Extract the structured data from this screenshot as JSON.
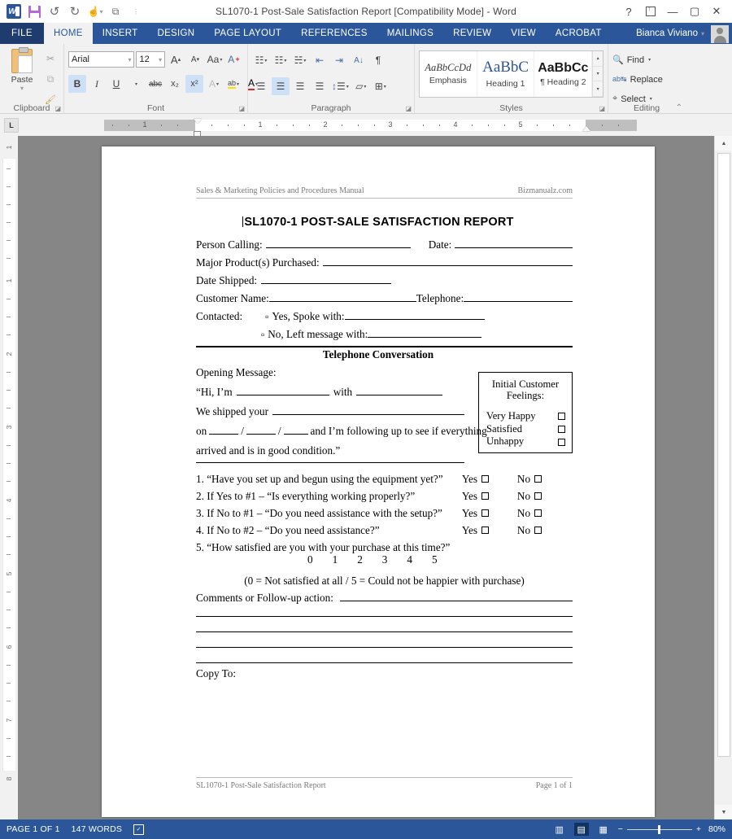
{
  "window": {
    "title": "SL1070-1 Post-Sale Satisfaction Report [Compatibility Mode] - Word",
    "qat": [
      {
        "name": "word-logo",
        "label": "W"
      },
      {
        "name": "save-icon",
        "label": ""
      },
      {
        "name": "undo-icon",
        "label": "↺"
      },
      {
        "name": "redo-icon",
        "label": "↻"
      },
      {
        "name": "touch-mode-icon",
        "label": ""
      },
      {
        "name": "customize-qat-icon",
        "label": "⌄"
      }
    ],
    "controls": {
      "help": "?",
      "ribbon_display": "ribbon-options",
      "minimize": "—",
      "maximize": "▢",
      "close": "✕"
    },
    "account": "Bianca Viviano"
  },
  "tabs": [
    {
      "id": "file",
      "label": "FILE",
      "active": false
    },
    {
      "id": "home",
      "label": "HOME",
      "active": true
    },
    {
      "id": "insert",
      "label": "INSERT",
      "active": false
    },
    {
      "id": "design",
      "label": "DESIGN",
      "active": false
    },
    {
      "id": "page-layout",
      "label": "PAGE LAYOUT",
      "active": false
    },
    {
      "id": "references",
      "label": "REFERENCES",
      "active": false
    },
    {
      "id": "mailings",
      "label": "MAILINGS",
      "active": false
    },
    {
      "id": "review",
      "label": "REVIEW",
      "active": false
    },
    {
      "id": "view",
      "label": "VIEW",
      "active": false
    },
    {
      "id": "acrobat",
      "label": "ACROBAT",
      "active": false
    }
  ],
  "ribbon": {
    "groups": [
      {
        "id": "clipboard",
        "label": "Clipboard"
      },
      {
        "id": "font",
        "label": "Font"
      },
      {
        "id": "paragraph",
        "label": "Paragraph"
      },
      {
        "id": "styles",
        "label": "Styles"
      },
      {
        "id": "editing",
        "label": "Editing"
      }
    ],
    "clipboard": {
      "paste_label": "Paste",
      "cut": "✂",
      "copy": "⧉",
      "format_painter": "🖌"
    },
    "font": {
      "font_name": "Arial",
      "font_size": "12",
      "grow_font": "A",
      "shrink_font": "A",
      "change_case": "Aa",
      "clear_formatting": "A",
      "bold": "B",
      "italic": "I",
      "underline": "U",
      "strikethrough": "abc",
      "subscript": "x₂",
      "superscript": "x²",
      "text_effects": "A",
      "highlight": "ab",
      "font_color": "A"
    },
    "paragraph": {
      "bullets": "•☰",
      "numbering": "1☰",
      "multilevel": "⊟☰",
      "decrease_indent": "⇤",
      "increase_indent": "⇥",
      "sort": "A↓",
      "show_marks": "¶",
      "align_left": "☰",
      "align_center": "☰",
      "align_right": "☰",
      "justify": "☰",
      "line_spacing": "↕☰",
      "shading": "▱",
      "borders": "⊞"
    },
    "styles": {
      "items": [
        {
          "preview": "AaBbCcDd",
          "name": "Emphasis"
        },
        {
          "preview": "AaBbC",
          "name": "Heading 1"
        },
        {
          "preview": "AaBbCc",
          "name": "¶ Heading 2"
        }
      ]
    },
    "editing": {
      "find": "Find",
      "replace": "Replace",
      "select": "Select"
    }
  },
  "ruler": {
    "tab_selector": "L",
    "horizontal_numbers": [
      "1",
      "1",
      "2",
      "3",
      "4",
      "5"
    ],
    "vertical_numbers": [
      "1",
      "1",
      "2",
      "3",
      "4",
      "5",
      "6",
      "7",
      "8"
    ]
  },
  "document": {
    "header_left": "Sales & Marketing Policies and Procedures Manual",
    "header_right": "Bizmanualz.com",
    "title": "SL1070-1 POST-SALE SATISFACTION REPORT",
    "fields": [
      {
        "label": "Person Calling:",
        "label2": "Date:"
      },
      {
        "label": "Major Product(s) Purchased:"
      },
      {
        "label": "Date Shipped:"
      },
      {
        "label": "Customer Name:",
        "label2": "Telephone:"
      },
      {
        "label": "Contacted:",
        "option1": "Yes, Spoke with:",
        "option2": "No, Left message with:"
      }
    ],
    "section_heading": "Telephone Conversation",
    "conversation": {
      "opening_label": "Opening Message:",
      "line1_a": "“Hi, I’m",
      "line1_b": "with",
      "line2_a": "We shipped your",
      "line3_a": "on",
      "line3_b": "and I’m following up to see if everything",
      "line4": "arrived and is in good condition.”"
    },
    "feelings_box": {
      "title_line1": "Initial Customer",
      "title_line2": "Feelings:",
      "options": [
        "Very Happy",
        "Satisfied",
        "Unhappy"
      ]
    },
    "questions": [
      {
        "text": "1. “Have you set up and begun using the equipment yet?”",
        "yes": "Yes",
        "no": "No"
      },
      {
        "text": "2. If Yes to #1 – “Is everything working properly?”",
        "yes": "Yes",
        "no": "No"
      },
      {
        "text": "3. If No to #1 – “Do you need assistance with the setup?”",
        "yes": "Yes",
        "no": "No"
      },
      {
        "text": "4. If No to #2 – “Do you need assistance?”",
        "yes": "Yes",
        "no": "No"
      }
    ],
    "question5": "5. “How satisfied are you with your purchase at this time?”",
    "scale_values": [
      "0",
      "1",
      "2",
      "3",
      "4",
      "5"
    ],
    "scale_note": "(0 = Not satisfied at all / 5 = Could not be happier with purchase)",
    "comments_label": "Comments or Follow-up action:",
    "copy_to_label": "Copy To:",
    "footer_left": "SL1070-1 Post-Sale Satisfaction Report",
    "footer_right": "Page 1 of 1"
  },
  "statusbar": {
    "page": "PAGE 1 OF 1",
    "words": "147 WORDS",
    "proofing": "proofing-icon",
    "views": [
      {
        "id": "read-mode",
        "label": "▥",
        "active": false
      },
      {
        "id": "print-layout",
        "label": "▤",
        "active": true
      },
      {
        "id": "web-layout",
        "label": "▦",
        "active": false
      }
    ],
    "zoom_out": "−",
    "zoom_in": "+",
    "zoom_level": "80%"
  },
  "colors": {
    "accent": "#2b579a",
    "file_tab": "#1e3c6e",
    "ribbon_bg": "#f1f1f1",
    "doc_bg": "#868686"
  }
}
